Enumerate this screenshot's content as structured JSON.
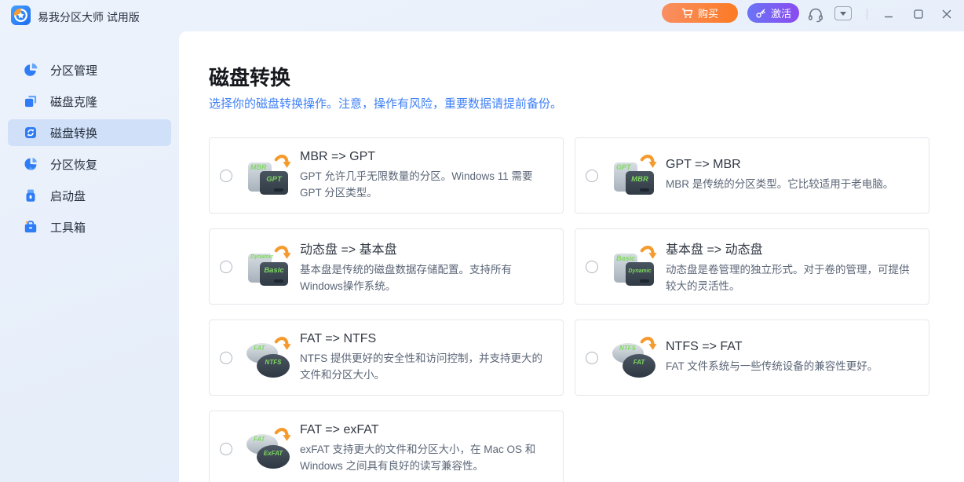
{
  "titlebar": {
    "title": "易我分区大师 试用版",
    "buy_label": "购买",
    "activate_label": "激活"
  },
  "sidebar": {
    "items": [
      {
        "label": "分区管理",
        "icon": "pie-chart-icon",
        "active": false
      },
      {
        "label": "磁盘克隆",
        "icon": "disk-clone-icon",
        "active": false
      },
      {
        "label": "磁盘转换",
        "icon": "disk-convert-icon",
        "active": true
      },
      {
        "label": "分区恢复",
        "icon": "partition-recovery-icon",
        "active": false
      },
      {
        "label": "启动盘",
        "icon": "boot-disk-icon",
        "active": false
      },
      {
        "label": "工具箱",
        "icon": "toolbox-icon",
        "active": false
      }
    ]
  },
  "main": {
    "title": "磁盘转换",
    "subtitle": "选择你的磁盘转换操作。注意，操作有风险，重要数据请提前备份。",
    "cards": [
      {
        "title": "MBR => GPT",
        "desc": "GPT 允许几乎无限数量的分区。Windows 11 需要 GPT 分区类型。",
        "icon_from": "MBR",
        "icon_to": "GPT",
        "selected": false
      },
      {
        "title": "GPT => MBR",
        "desc": "MBR 是传统的分区类型。它比较适用于老电脑。",
        "icon_from": "GPT",
        "icon_to": "MBR",
        "selected": false
      },
      {
        "title": "动态盘 => 基本盘",
        "desc": "基本盘是传统的磁盘数据存储配置。支持所有Windows操作系统。",
        "icon_from": "Dynamic",
        "icon_to": "Basic",
        "selected": false
      },
      {
        "title": "基本盘 => 动态盘",
        "desc": "动态盘是卷管理的独立形式。对于卷的管理，可提供较大的灵活性。",
        "icon_from": "Basic",
        "icon_to": "Dynamic",
        "selected": false
      },
      {
        "title": "FAT => NTFS",
        "desc": "NTFS 提供更好的安全性和访问控制，并支持更大的文件和分区大小。",
        "icon_from": "FAT",
        "icon_to": "NTFS",
        "selected": false
      },
      {
        "title": "NTFS => FAT",
        "desc": "FAT 文件系统与一些传统设备的兼容性更好。",
        "icon_from": "NTFS",
        "icon_to": "FAT",
        "selected": false
      },
      {
        "title": "FAT => exFAT",
        "desc": "exFAT 支持更大的文件和分区大小，在 Mac OS 和 Windows 之间具有良好的读写兼容性。",
        "icon_from": "FAT",
        "icon_to": "ExFAT",
        "selected": false
      }
    ]
  },
  "colors": {
    "accent_blue": "#2e7cf6",
    "subtitle_blue": "#3f80f7",
    "active_item_bg": "#cfe0f8",
    "buy_gradient_start": "#f98f62",
    "buy_gradient_end": "#fc7a23",
    "activate_gradient_start": "#6a74f5",
    "activate_gradient_end": "#8a4bf0",
    "disk_label_green": "#7fd95e",
    "arrow_orange": "#f59b2e"
  }
}
